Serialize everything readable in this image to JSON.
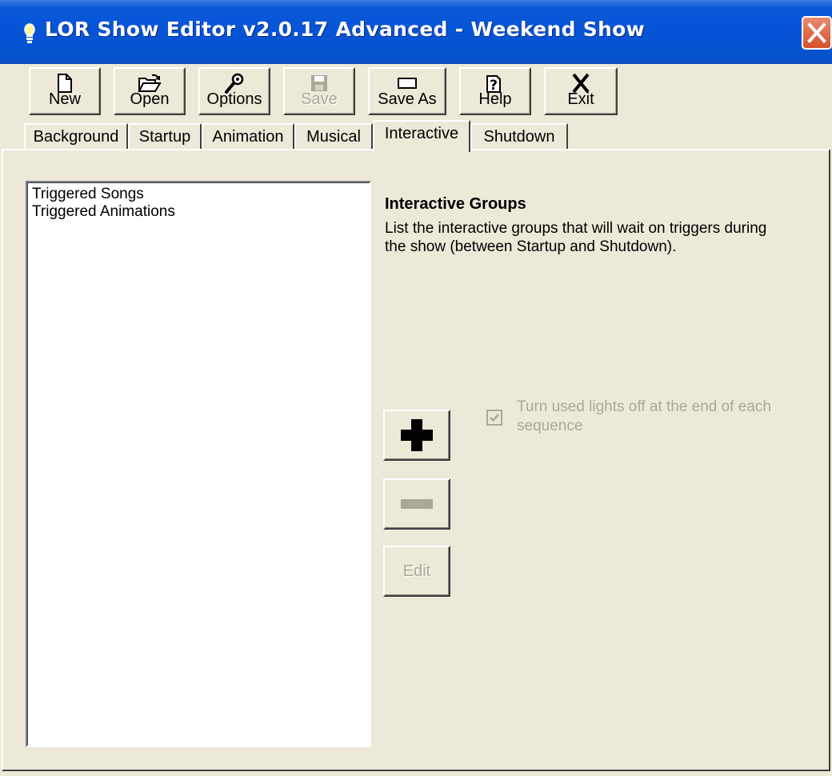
{
  "window": {
    "title": "LOR Show Editor v2.0.17 Advanced - Weekend Show"
  },
  "toolbar": {
    "buttons": [
      {
        "label": "New",
        "icon": "new-file-icon",
        "enabled": true
      },
      {
        "label": "Open",
        "icon": "open-folder-icon",
        "enabled": true
      },
      {
        "label": "Options",
        "icon": "wrench-icon",
        "enabled": true
      },
      {
        "label": "Save",
        "icon": "floppy-disk-icon",
        "enabled": false
      },
      {
        "label": "Save As",
        "icon": "rectangle-icon",
        "enabled": true
      },
      {
        "label": "Help",
        "icon": "help-icon",
        "enabled": true
      },
      {
        "label": "Exit",
        "icon": "x-icon",
        "enabled": true
      }
    ]
  },
  "tabs": [
    {
      "label": "Background",
      "active": false
    },
    {
      "label": "Startup",
      "active": false
    },
    {
      "label": "Animation",
      "active": false
    },
    {
      "label": "Musical",
      "active": false
    },
    {
      "label": "Interactive",
      "active": true
    },
    {
      "label": "Shutdown",
      "active": false
    }
  ],
  "panel": {
    "list_items": [
      "Triggered Songs",
      "Triggered Animations"
    ],
    "heading": "Interactive Groups",
    "description": "List the interactive groups that will wait on triggers during the show (between Startup and Shutdown).",
    "add_icon": "plus-icon",
    "remove_icon": "minus-icon",
    "edit_label": "Edit",
    "edit_enabled": false,
    "remove_enabled": false,
    "lights_off_label": "Turn used lights off at the end of each sequence",
    "lights_off_checked": true,
    "lights_off_enabled": false
  },
  "colors": {
    "titlebar": "#0654d6",
    "face": "#ece9d8",
    "disabled_text": "#aca899"
  }
}
